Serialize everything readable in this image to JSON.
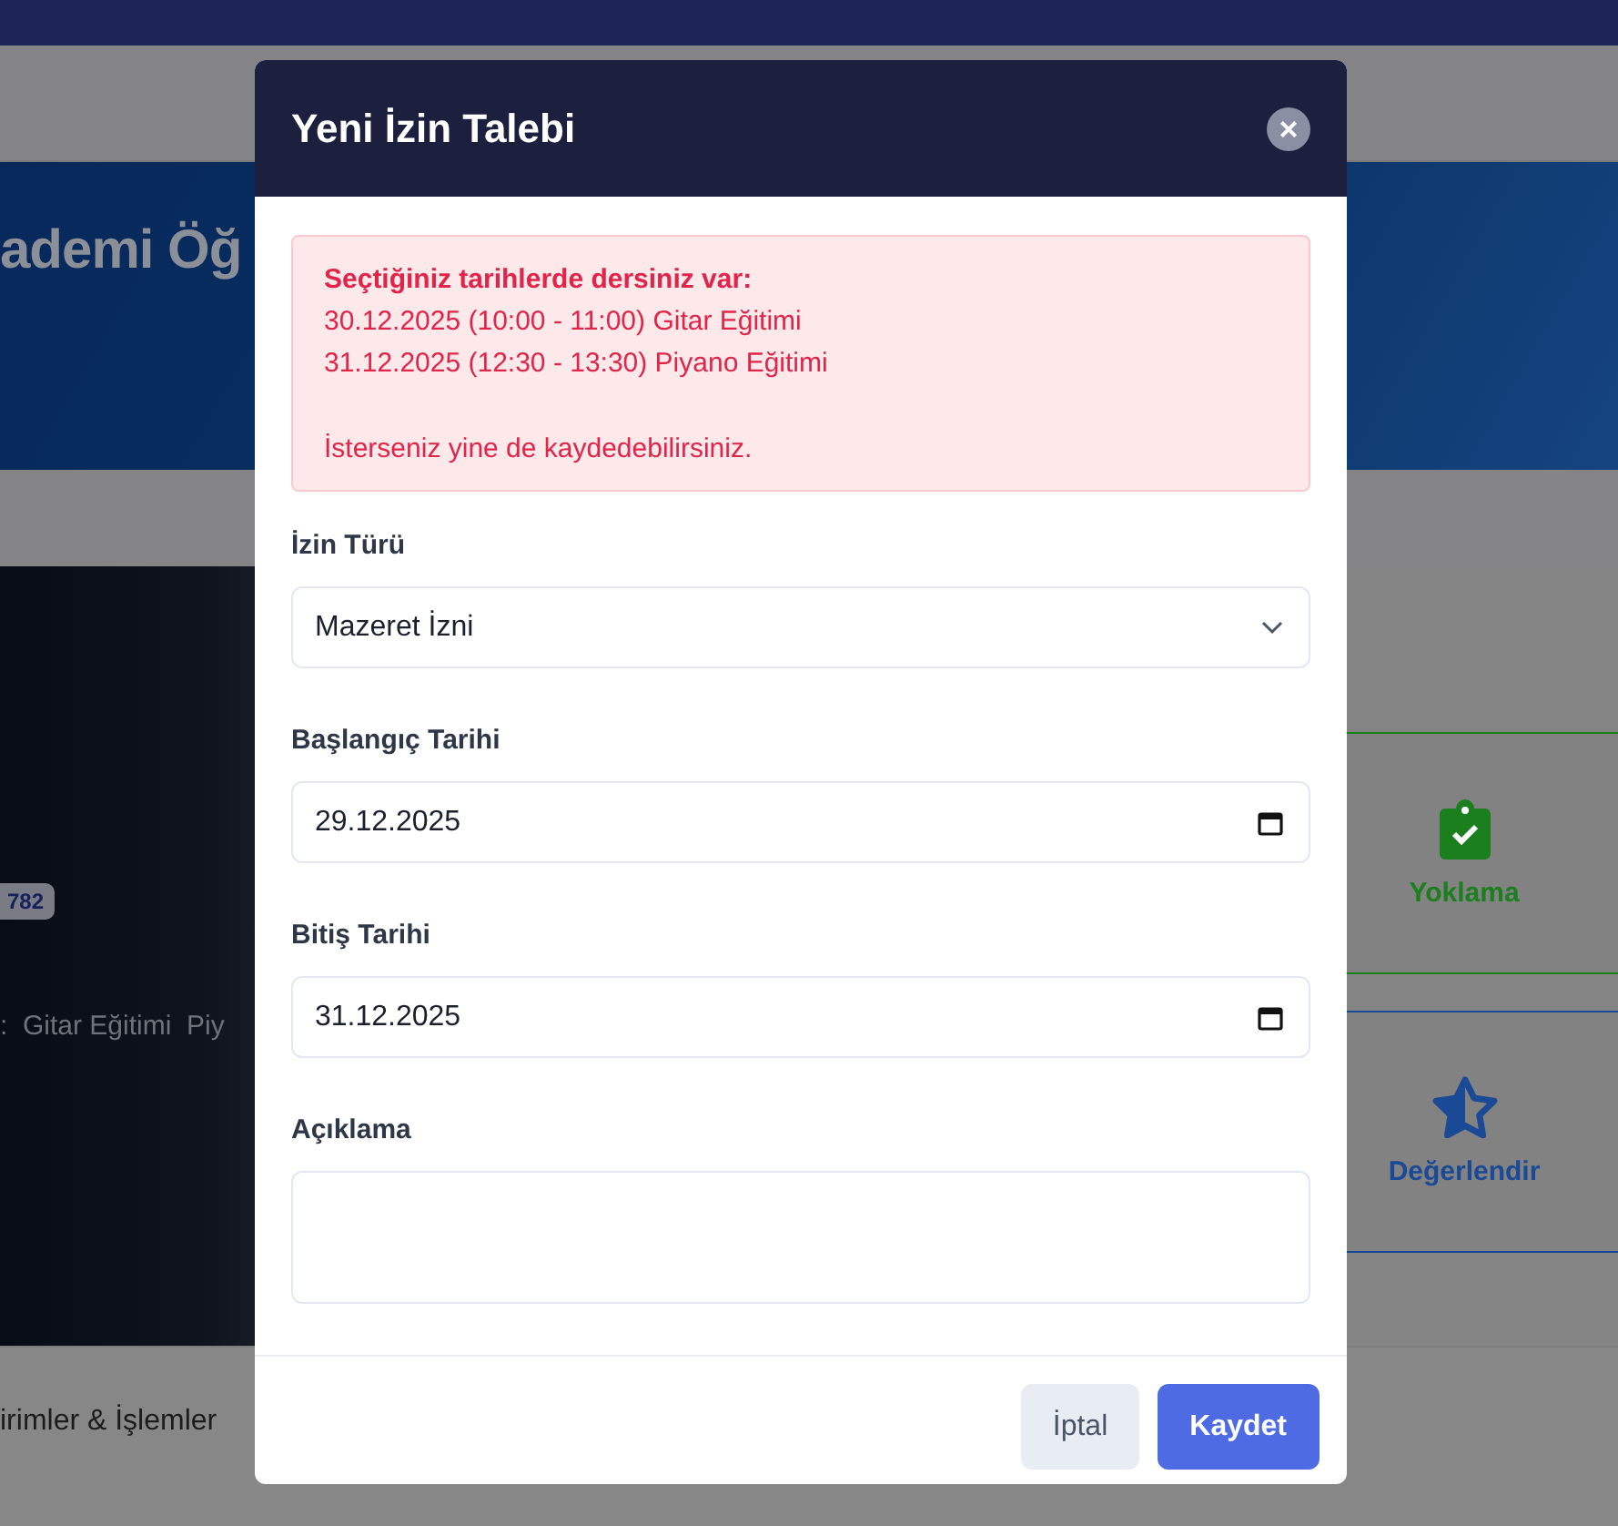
{
  "background": {
    "hero_title": "ademi Öğ",
    "badge": "782",
    "course_line": ":  Gitar Eğitimi  Piy",
    "actions": [
      {
        "label": "Yoklama",
        "kind": "attendance",
        "color": "#1b7f1e"
      },
      {
        "label": "Değerlendir",
        "kind": "rate",
        "color": "#1a4a96"
      }
    ],
    "section_title": "irimler & İşlemler"
  },
  "modal": {
    "title": "Yeni İzin Talebi",
    "close": "×",
    "alert": {
      "heading": "Seçtiğiniz tarihlerde dersiniz var:",
      "lines": [
        "30.12.2025 (10:00 - 11:00) Gitar Eğitimi",
        "31.12.2025 (12:30 - 13:30) Piyano Eğitimi"
      ],
      "note": "İsterseniz yine de kaydedebilirsiniz."
    },
    "fields": [
      {
        "label": "İzin Türü",
        "kind": "select",
        "value": "Mazeret İzni"
      },
      {
        "label": "Başlangıç Tarihi",
        "kind": "date",
        "value": "29.12.2025"
      },
      {
        "label": "Bitiş Tarihi",
        "kind": "date",
        "value": "31.12.2025"
      },
      {
        "label": "Açıklama",
        "kind": "textarea"
      }
    ],
    "buttons": [
      {
        "label": "İptal",
        "kind": "secondary"
      },
      {
        "label": "Kaydet",
        "kind": "primary"
      }
    ]
  }
}
